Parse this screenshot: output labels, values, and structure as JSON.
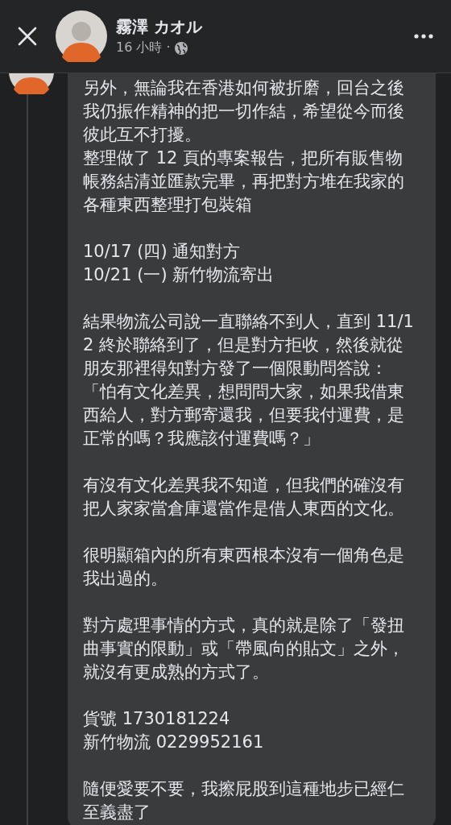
{
  "header": {
    "name": "霧澤 カオル",
    "time": "16 小時 ·"
  },
  "comment": {
    "blocks": [
      [
        "另外，無論我在香港如何被折磨，回台之後我仍振作精神的把一切作結，希望從今而後彼此互不打擾。",
        "整理做了 12 頁的專案報告，把所有販售物帳務結清並匯款完畢，再把對方堆在我家的各種東西整理打包裝箱"
      ],
      [
        "10/17 (四) 通知對方",
        "10/21 (一) 新竹物流寄出"
      ],
      [
        "結果物流公司說一直聯絡不到人，直到 11/12 終於聯絡到了，但是對方拒收，然後就從朋友那裡得知對方發了一個限動問答說：「怕有文化差異，想問問大家，如果我借東西給人，對方郵寄還我，但要我付運費，是正常的嗎？我應該付運費嗎？」"
      ],
      [
        "有沒有文化差異我不知道，但我們的確沒有把人家家當倉庫還當作是借人東西的文化。"
      ],
      [
        "很明顯箱內的所有東西根本沒有一個角色是我出過的。"
      ],
      [
        "對方處理事情的方式，真的就是除了「發扭曲事實的限動」或「帶風向的貼文」之外，就沒有更成熟的方式了。"
      ],
      [
        "貨號 1730181224",
        "新竹物流 0229952161"
      ],
      [
        "隨便愛要不要，我擦屁股到這種地步已經仁至義盡了"
      ]
    ]
  }
}
